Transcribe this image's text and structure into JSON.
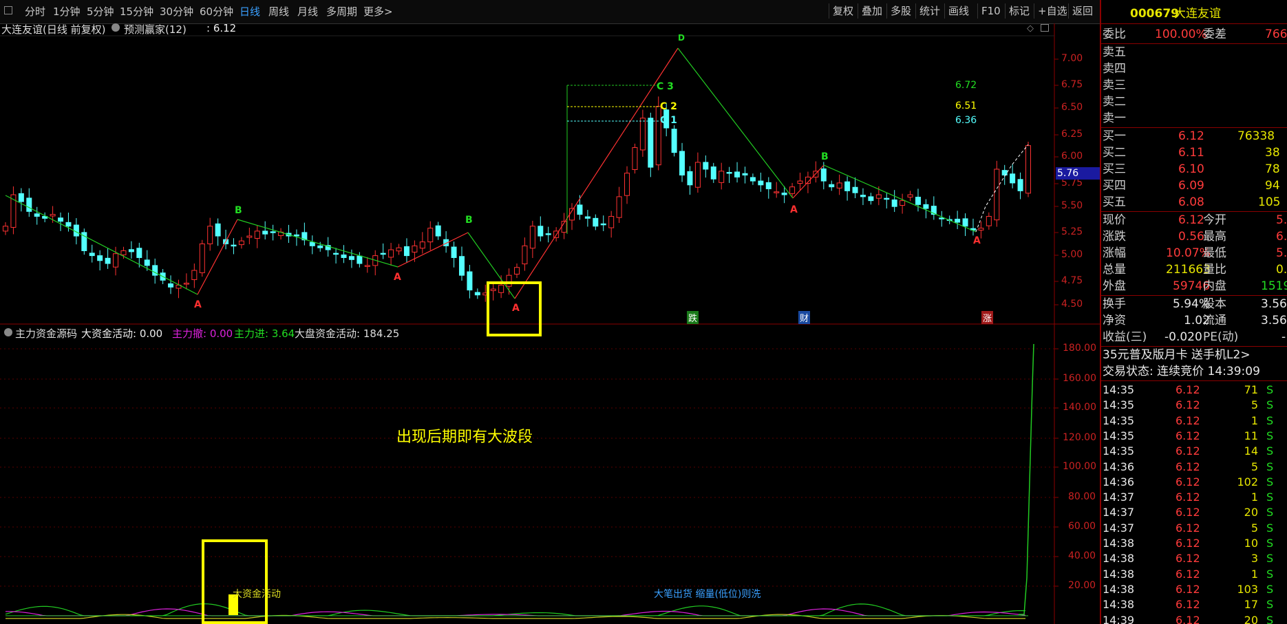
{
  "toolbar": {
    "periods": [
      "分时",
      "1分钟",
      "5分钟",
      "15分钟",
      "30分钟",
      "60分钟",
      "日线",
      "周线",
      "月线",
      "多周期",
      "更多>"
    ],
    "active_period": "日线",
    "right_buttons": [
      "复权",
      "叠加",
      "多股",
      "统计",
      "画线",
      "F10",
      "标记",
      "+自选",
      "返回"
    ]
  },
  "main_chart": {
    "title": "大连友谊(日线 前复权)",
    "indicator": "预测赢家(12)",
    "indicator_value": ": 6.12",
    "price_axis": [
      "7.00",
      "6.75",
      "6.50",
      "6.25",
      "6.00",
      "5.75",
      "5.50",
      "5.25",
      "5.00",
      "4.75",
      "4.50"
    ],
    "current_price_tag": "5.76",
    "labels": {
      "a": "A",
      "b": "B",
      "c1": "C 1",
      "c2": "C 2",
      "c3": "C 3",
      "d": "D"
    },
    "target_values": [
      "6.72",
      "6.51",
      "6.36"
    ],
    "event_tags": [
      "跌",
      "财",
      "涨"
    ]
  },
  "sub_chart": {
    "name": "主力资金源码",
    "big_fund_label": "大资金活动: 0.00",
    "main_out_label": "主力撤: 0.00",
    "main_in_label": "主力进: 3.64",
    "market_label": "大盘资金活动: 184.25",
    "axis": [
      "180.00",
      "160.00",
      "140.00",
      "120.00",
      "100.00",
      "80.00",
      "60.00",
      "40.00",
      "20.00"
    ],
    "annotation": "出现后期即有大波段",
    "note_left": "大资金活动",
    "note_right": "大笔出货 缩量(低位)则洗"
  },
  "colors": {
    "up": "#ff3232",
    "down": "#54ffff",
    "green": "#22cc22",
    "yellow": "#ffff00",
    "magenta": "#dd22dd",
    "grid": "#8b0000",
    "accent": "#3aa0ff"
  },
  "quote": {
    "code": "000679",
    "name": "大连友谊",
    "weibi_label": "委比",
    "weibi": "100.00%",
    "weicha_label": "委差",
    "weicha": "766",
    "sells": [
      {
        "label": "卖五"
      },
      {
        "label": "卖四"
      },
      {
        "label": "卖三"
      },
      {
        "label": "卖二"
      },
      {
        "label": "卖一"
      }
    ],
    "buys": [
      {
        "label": "买一",
        "price": "6.12",
        "vol": "76338"
      },
      {
        "label": "买二",
        "price": "6.11",
        "vol": "38"
      },
      {
        "label": "买三",
        "price": "6.10",
        "vol": "78"
      },
      {
        "label": "买四",
        "price": "6.09",
        "vol": "94"
      },
      {
        "label": "买五",
        "price": "6.08",
        "vol": "105"
      }
    ],
    "stats": [
      {
        "l1": "现价",
        "v1": "6.12",
        "l2": "今开",
        "v2": "5."
      },
      {
        "l1": "涨跌",
        "v1": "0.56",
        "l2": "最高",
        "v2": "6."
      },
      {
        "l1": "涨幅",
        "v1": "10.07%",
        "l2": "最低",
        "v2": "5."
      },
      {
        "l1": "总量",
        "v1": "211663",
        "l2": "量比",
        "v2": "0."
      },
      {
        "l1": "外盘",
        "v1": "59746",
        "l2": "内盘",
        "v2": "1519"
      }
    ],
    "stats2": [
      {
        "l1": "换手",
        "v1": "5.94%",
        "l2": "股本",
        "v2": "3.56"
      },
      {
        "l1": "净资",
        "v1": "1.02",
        "l2": "流通",
        "v2": "3.56"
      },
      {
        "l1": "收益(三)",
        "v1": "-0.020",
        "l2": "PE(动)",
        "v2": "-"
      }
    ],
    "promo": "35元普及版月卡 送手机L2>",
    "status": "交易状态: 连续竞价 14:39:09",
    "ticks": [
      {
        "t": "14:35",
        "p": "6.12",
        "v": "71",
        "s": "S"
      },
      {
        "t": "14:35",
        "p": "6.12",
        "v": "5",
        "s": "S"
      },
      {
        "t": "14:35",
        "p": "6.12",
        "v": "1",
        "s": "S"
      },
      {
        "t": "14:35",
        "p": "6.12",
        "v": "11",
        "s": "S"
      },
      {
        "t": "14:35",
        "p": "6.12",
        "v": "14",
        "s": "S"
      },
      {
        "t": "14:36",
        "p": "6.12",
        "v": "5",
        "s": "S"
      },
      {
        "t": "14:36",
        "p": "6.12",
        "v": "102",
        "s": "S"
      },
      {
        "t": "14:37",
        "p": "6.12",
        "v": "1",
        "s": "S"
      },
      {
        "t": "14:37",
        "p": "6.12",
        "v": "20",
        "s": "S"
      },
      {
        "t": "14:37",
        "p": "6.12",
        "v": "5",
        "s": "S"
      },
      {
        "t": "14:38",
        "p": "6.12",
        "v": "10",
        "s": "S"
      },
      {
        "t": "14:38",
        "p": "6.12",
        "v": "3",
        "s": "S"
      },
      {
        "t": "14:38",
        "p": "6.12",
        "v": "1",
        "s": "S"
      },
      {
        "t": "14:38",
        "p": "6.12",
        "v": "103",
        "s": "S"
      },
      {
        "t": "14:38",
        "p": "6.12",
        "v": "17",
        "s": "S"
      },
      {
        "t": "14:39",
        "p": "6.12",
        "v": "20",
        "s": "S"
      }
    ]
  }
}
